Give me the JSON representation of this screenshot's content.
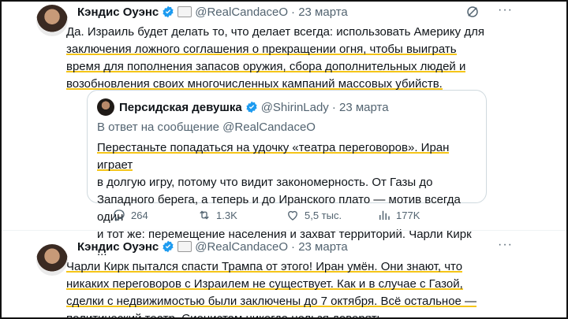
{
  "tweet1": {
    "name": "Кэндис Оуэнс",
    "handle": "@RealCandaceO",
    "date": "· 23 марта",
    "more": "···",
    "lines": [
      "Да. Израиль будет делать то, что делает всегда: использовать Америку для",
      "заключения ложного соглашения о прекращении огня, чтобы выиграть",
      "время для пополнения запасов оружия, сбора дополнительных людей и",
      "возобновления своих многочисленных кампаний массовых убийств."
    ]
  },
  "quote": {
    "name": "Персидская девушка",
    "handle": "@ShirinLady",
    "date": "· 23 марта",
    "reply_to": "В ответ на сообщение @RealCandaceO",
    "lines": [
      "Перестаньте попадаться на удочку «театра переговоров». Иран играет",
      "в долгую игру, потому что видит закономерность. От Газы до",
      "Западного берега, а теперь и до Иранского плато — мотив всегда один",
      "и тот же: перемещение населения и захват территорий. Чарли Кирк ..."
    ]
  },
  "actions": {
    "replies": "264",
    "reposts": "1.3K",
    "likes": "5,5 тыс.",
    "views": "177K"
  },
  "tweet2": {
    "name": "Кэндис Оуэнс",
    "handle": "@RealCandaceO",
    "date": "· 23 марта",
    "more": "···",
    "lines": [
      "Чарли Кирк пытался спасти Трампа от этого! Иран умён. Они знают, что",
      "никаких переговоров с Израилем не существует. Как и в случае с Газой,",
      "сделки с недвижимостью были заключены до 7 октября. Всё остальное —",
      "политический театр. Сионистам никогда нельзя доверять."
    ]
  },
  "colors": {
    "accent": "#1d9bf0",
    "highlight": "#f5c518",
    "muted": "#536471"
  }
}
